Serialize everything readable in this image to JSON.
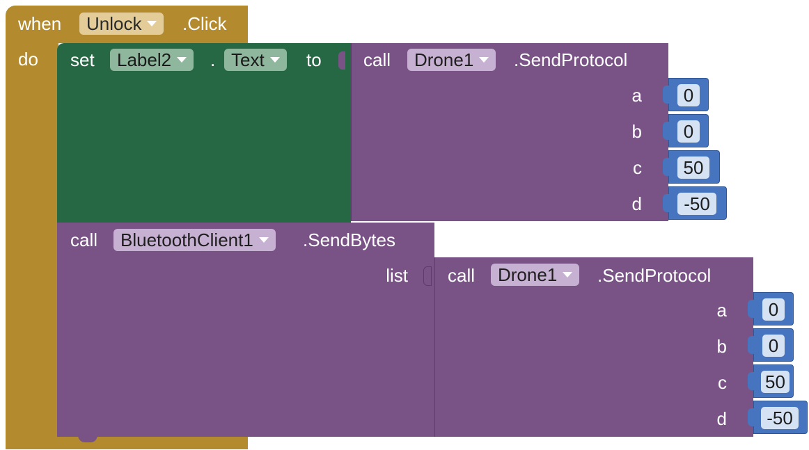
{
  "event": {
    "when": "when",
    "component": "Unlock",
    "event_name": ".Click",
    "do": "do"
  },
  "set_block": {
    "set": "set",
    "component": "Label2",
    "dot": ".",
    "property": "Text",
    "to": "to"
  },
  "call1": {
    "call": "call",
    "component": "Drone1",
    "method": ".SendProtocol",
    "args": [
      {
        "name": "a",
        "value": "0"
      },
      {
        "name": "b",
        "value": "0"
      },
      {
        "name": "c",
        "value": "50"
      },
      {
        "name": "d",
        "value": "-50"
      }
    ]
  },
  "call_bt": {
    "call": "call",
    "component": "BluetoothClient1",
    "method": ".SendBytes",
    "list": "list"
  },
  "call2": {
    "call": "call",
    "component": "Drone1",
    "method": ".SendProtocol",
    "args": [
      {
        "name": "a",
        "value": "0"
      },
      {
        "name": "b",
        "value": "0"
      },
      {
        "name": "c",
        "value": "50"
      },
      {
        "name": "d",
        "value": "-50"
      }
    ]
  },
  "colors": {
    "event": "#b38b2e",
    "set": "#266843",
    "procedure": "#7a5386",
    "math": "#4774bf"
  }
}
